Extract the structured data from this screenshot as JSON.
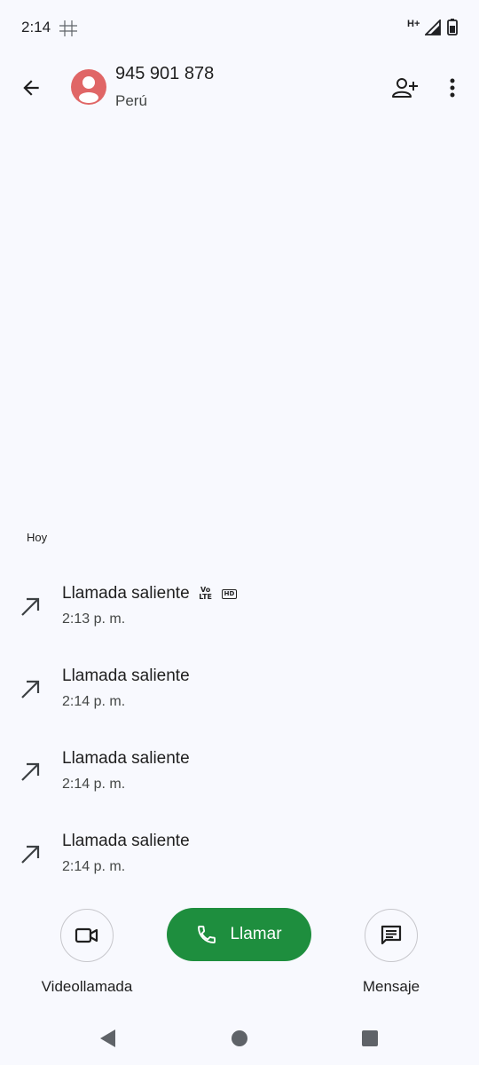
{
  "status_bar": {
    "time": "2:14",
    "network": "H+",
    "icons": [
      "grid-notification-icon",
      "signal-icon",
      "battery-icon"
    ]
  },
  "header": {
    "phone_number": "945 901 878",
    "location": "Perú",
    "avatar_color": "#e06666",
    "icons": [
      "back-arrow-icon",
      "add-contact-icon",
      "more-vert-icon"
    ]
  },
  "history": {
    "section_label": "Hoy",
    "calls": [
      {
        "type": "Llamada saliente",
        "time": "2:13 p. m.",
        "volte_top": "Vo",
        "volte_bottom": "LTE",
        "hd": "HD"
      },
      {
        "type": "Llamada saliente",
        "time": "2:14 p. m."
      },
      {
        "type": "Llamada saliente",
        "time": "2:14 p. m."
      },
      {
        "type": "Llamada saliente",
        "time": "2:14 p. m."
      }
    ]
  },
  "actions": {
    "video_call_label": "Videollamada",
    "call_label": "Llamar",
    "message_label": "Mensaje",
    "call_button_color": "#1e8e3e"
  },
  "nav": {
    "icons": [
      "nav-back-icon",
      "nav-home-icon",
      "nav-recents-icon"
    ]
  }
}
